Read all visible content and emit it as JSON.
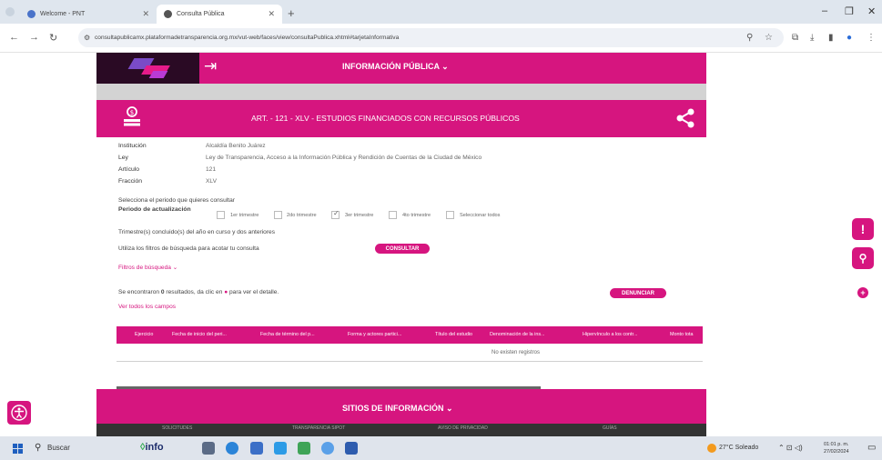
{
  "browser": {
    "tabs": [
      {
        "label": "Welcome - PNT"
      },
      {
        "label": "Consulta Pública"
      }
    ],
    "url": "consultapublicamx.plataformadetransparencia.org.mx/vut-web/faces/view/consultaPublica.xhtml#tarjetaInformativa"
  },
  "topnav": {
    "menu_label": "INFORMACIÓN PÚBLICA ⌄"
  },
  "header": {
    "title": "ART. - 121 - XLV - ESTUDIOS FINANCIADOS CON RECURSOS PÚBLICOS"
  },
  "details": [
    {
      "label": "Institución",
      "value": "Alcaldía Benito Juárez"
    },
    {
      "label": "Ley",
      "value": "Ley de Transparencia, Acceso a la Información Pública y Rendición de Cuentas de la Ciudad de México"
    },
    {
      "label": "Artículo",
      "value": "121"
    },
    {
      "label": "Fracción",
      "value": "XLV"
    }
  ],
  "period": {
    "prompt": "Selecciona el periodo que quieres consultar",
    "label": "Periodo de actualización",
    "options": [
      {
        "label": "1er trimestre",
        "checked": false
      },
      {
        "label": "2do trimestre",
        "checked": false
      },
      {
        "label": "3er trimestre",
        "checked": true
      },
      {
        "label": "4to trimestre",
        "checked": false
      },
      {
        "label": "Seleccionar todos",
        "checked": false
      }
    ],
    "note": "Trimestre(s) concluido(s) del año en curso y dos anteriores"
  },
  "filters": {
    "hint": "Utiliza los filtros de búsqueda para acotar tu consulta",
    "consultar_label": "CONSULTAR",
    "toggle_label": "Filtros de búsqueda ⌄"
  },
  "results": {
    "text_before": "Se encontraron ",
    "count": "0",
    "text_mid": " resultados, da clic en ",
    "text_after": " para ver el detalle.",
    "denunciar_label": "DENUNCIAR",
    "see_all": "Ver todos los campos"
  },
  "table": {
    "columns": [
      "Ejercicio",
      "Fecha de inicio del peri...",
      "Fecha de término del p...",
      "Forma y actores partici...",
      "Título del estudio",
      "Denominación de la ins...",
      "Hipervínculo a los contr...",
      "Monto tota"
    ],
    "empty": "No existen registros"
  },
  "footer": {
    "sitios_label": "SITIOS DE INFORMACIÓN ⌄",
    "links": [
      "SOLICITUDES",
      "TRANSPARENCIA SIPOT",
      "AVISO DE PRIVACIDAD",
      "GUÍAS"
    ]
  },
  "taskbar": {
    "search": "Buscar",
    "weather": "27°C  Soleado",
    "time": "01:01 p. m.",
    "date": "27/02/2024",
    "info_logo": "info"
  },
  "colors": {
    "brand": "#d6157f",
    "dark": "#2a0a24"
  }
}
